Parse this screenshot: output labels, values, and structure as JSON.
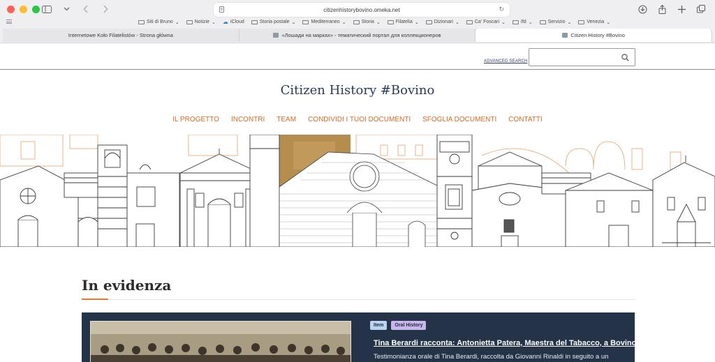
{
  "browser": {
    "url": "citizenhistorybovino.omeka.net",
    "bookmarks": [
      {
        "label": "Siti di Bruno",
        "type": "folder"
      },
      {
        "label": "Notizie",
        "type": "folder"
      },
      {
        "label": "iCloud",
        "type": "cloud"
      },
      {
        "label": "Storia postale",
        "type": "folder"
      },
      {
        "label": "Mediterraneo",
        "type": "folder"
      },
      {
        "label": "Storia",
        "type": "folder"
      },
      {
        "label": "Filatelia",
        "type": "folder"
      },
      {
        "label": "Dizionari",
        "type": "folder"
      },
      {
        "label": "Ca' Foscari",
        "type": "folder"
      },
      {
        "label": "Ifd",
        "type": "folder"
      },
      {
        "label": "Servizio",
        "type": "folder"
      },
      {
        "label": "Venezia",
        "type": "folder"
      }
    ],
    "tabs": [
      {
        "label": "Internetowe Koło Filatelistów - Strona główna",
        "active": false
      },
      {
        "label": "«Лошади на марках» - тематический портал для коллекционеров",
        "active": false
      },
      {
        "label": "Citizen History #Bovino",
        "active": true
      }
    ]
  },
  "header": {
    "advanced_search": "ADVANCED SEARCH",
    "search_placeholder": ""
  },
  "site": {
    "title": "Citizen History #Bovino",
    "nav": [
      "IL PROGETTO",
      "INCONTRI",
      "TEAM",
      "CONDIVIDI I TUOI DOCUMENTI",
      "SFOGLIA DOCUMENTI",
      "CONTATTI"
    ]
  },
  "featured": {
    "heading": "In evidenza",
    "card": {
      "tags": [
        "Item",
        "Oral History"
      ],
      "title": "Tina Berardi racconta: Antonietta Patera, Maestra del Tabacco, a Bovino",
      "description": "Testimonianza orale di Tina Berardi, raccolta da Giovanni Rinaldi in seguito a un"
    }
  },
  "colors": {
    "nav": "#d9691f",
    "title": "#2a3a57",
    "card_bg": "#243348",
    "accent": "#e07a2e"
  }
}
